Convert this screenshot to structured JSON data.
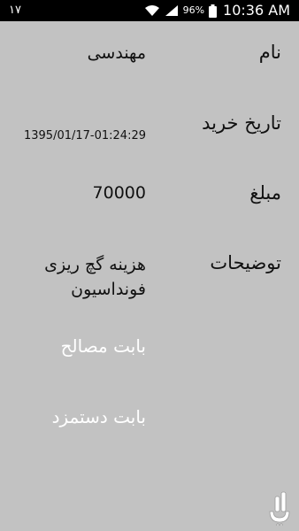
{
  "status_bar": {
    "notification_number": "١٧",
    "battery_percent": "96%",
    "time": "10:36 AM",
    "icons": [
      "wifi-icon",
      "signal-icon",
      "battery-icon"
    ]
  },
  "fields": {
    "name": {
      "label": "نام",
      "value": "مهندسی"
    },
    "purchase_date": {
      "label": "تاریخ خرید",
      "value": "1395/01/17-01:24:29"
    },
    "amount": {
      "label": "مبلغ",
      "value": "70000"
    },
    "description": {
      "label": "توضیحات",
      "value": "هزینه گچ ریزی فونداسیون"
    }
  },
  "links": {
    "materials": "بابت مصالح",
    "wages": "بابت دستمزد"
  },
  "colors": {
    "background": "#c2c2c2",
    "status_bar": "#000000",
    "link_text": "#ffffff",
    "text": "#111111"
  },
  "logo_icon": "app-logo-icon"
}
